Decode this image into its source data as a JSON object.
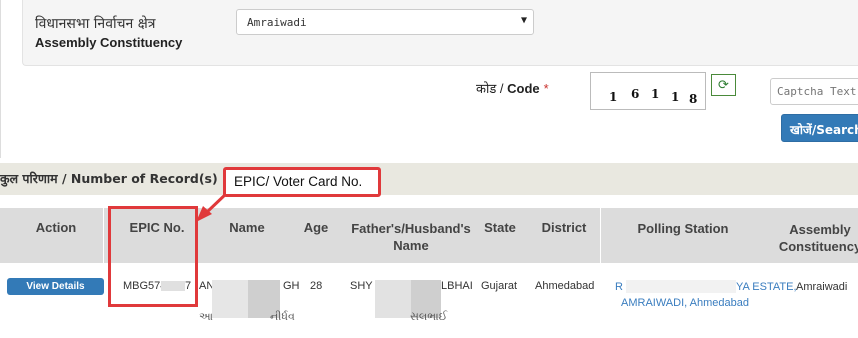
{
  "form": {
    "constituency_label_hi": "विधानसभा निर्वाचन क्षेत्र",
    "constituency_label_en": "Assembly Constituency",
    "constituency_value": "Amraiwadi",
    "code_label_hi": "कोड",
    "code_separator": " / ",
    "code_label_en": "Code",
    "required_mark": "*",
    "captcha_digits": [
      "1",
      "6",
      "1",
      "1",
      "8"
    ],
    "refresh_icon": "refresh-icon",
    "captcha_placeholder": "Captcha Text",
    "search_label": "खोजें/Search"
  },
  "records": {
    "label": "कुल परिणाम / Number of Record(s) Fo"
  },
  "annotation": {
    "callout_text": "EPIC/ Voter Card No.",
    "color": "#e0393b"
  },
  "table": {
    "headers": {
      "action": "Action",
      "epic": "EPIC No.",
      "name": "Name",
      "age": "Age",
      "father": "Father's/Husband's Name",
      "state": "State",
      "district": "District",
      "polling": "Polling Station",
      "assembly": "Assembly Constituency"
    },
    "rows": [
      {
        "action_label": "View Details",
        "epic_prefix": "MBG574",
        "epic_suffix": "7",
        "name_start": "AN",
        "name_end": "GH",
        "name_second_line": "આ",
        "name_second_end": "નીર્ધવ",
        "age": "28",
        "father_start": "SHY",
        "father_end": "LBHAI",
        "father_second_line": "સલભાઈ",
        "state": "Gujarat",
        "district": "Ahmedabad",
        "polling_line1_start": "R",
        "polling_line1_end": "YA ESTATE,",
        "polling_line2": "AMRAIWADI, Ahmedabad",
        "assembly": "Amraiwadi"
      }
    ]
  },
  "colors": {
    "primary_button": "#337ab7",
    "link": "#3a7dbf",
    "header_bg": "#dcdcdc",
    "record_bar_bg": "#e9e8e0"
  }
}
